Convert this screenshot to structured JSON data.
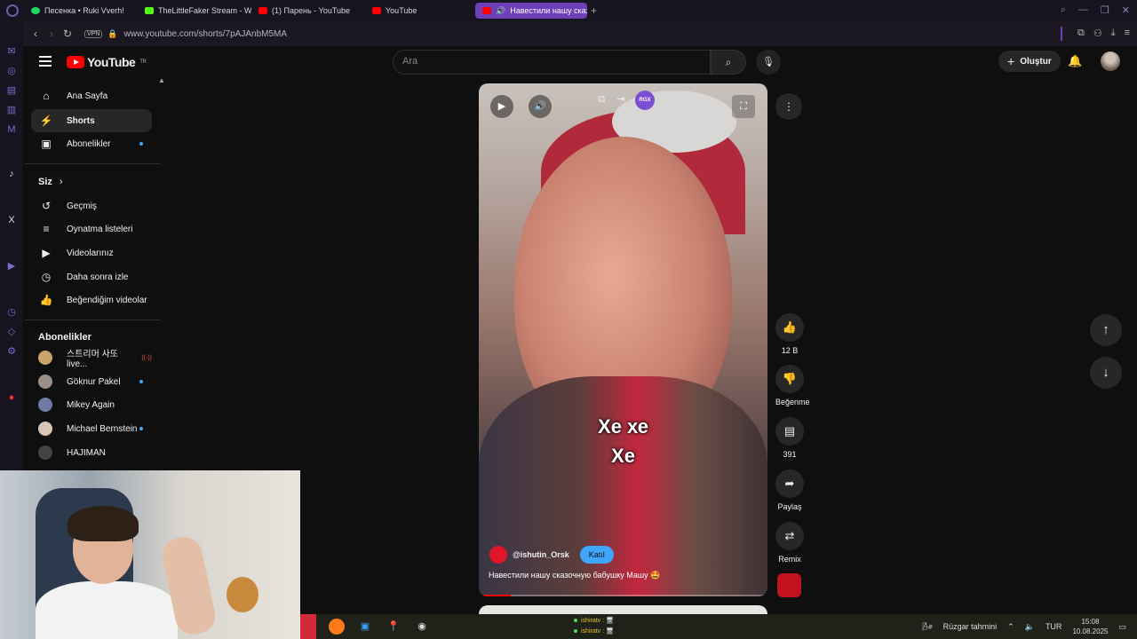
{
  "browser": {
    "tabs": [
      {
        "label": "Песенка • Ruki Vverh!",
        "color": "#1ed760"
      },
      {
        "label": "TheLittleFaker Stream - W",
        "color": "#53fc18"
      },
      {
        "label": "(1) Парень - YouTube",
        "color": "#ff0000"
      },
      {
        "label": "YouTube",
        "color": "#ff0000"
      },
      {
        "label": "Навестили нашу сказ",
        "color": "#ff0000",
        "active": true
      }
    ],
    "new_tab": "+",
    "vpn_label": "VPN",
    "url": "www.youtube.com/shorts/7pAJAnbM5MA"
  },
  "youtube": {
    "logo_text": "YouTube",
    "country_code": "TR",
    "search_placeholder": "Ara",
    "create_label": "Oluştur"
  },
  "guide": {
    "main": [
      {
        "label": "Ana Sayfa",
        "icon": "home-icon",
        "glyph": "⌂"
      },
      {
        "label": "Shorts",
        "icon": "shorts-icon",
        "glyph": "⚡",
        "selected": true
      },
      {
        "label": "Abonelikler",
        "icon": "subscriptions-icon",
        "glyph": "▣",
        "dot": true
      }
    ],
    "you_header": "Siz",
    "you": [
      {
        "label": "Geçmiş",
        "icon": "history-icon",
        "glyph": "↺"
      },
      {
        "label": "Oynatma listeleri",
        "icon": "playlists-icon",
        "glyph": "≡"
      },
      {
        "label": "Videolarınız",
        "icon": "your-videos-icon",
        "glyph": "▶"
      },
      {
        "label": "Daha sonra izle",
        "icon": "watch-later-icon",
        "glyph": "◷"
      },
      {
        "label": "Beğendiğim videolar",
        "icon": "liked-videos-icon",
        "glyph": "👍"
      }
    ],
    "subs_header": "Abonelikler",
    "subs": [
      {
        "label": "스트리머 사또 live...",
        "color": "#c9a46a",
        "live": true
      },
      {
        "label": "Göknur Pakel",
        "color": "#9a8f86",
        "dot": true
      },
      {
        "label": "Mikey Again",
        "color": "#6d7aa8"
      },
      {
        "label": "Michael Bernstein",
        "color": "#d8c6b6",
        "dot": true
      },
      {
        "label": "HAJIMAN",
        "color": "#444444"
      }
    ]
  },
  "short": {
    "caption_line1": "Хе хе",
    "caption_line2": "Хе",
    "channel": "@ishutin_Orsk",
    "join_label": "Katıl",
    "description": "Навестили нашу сказочную бабушку Машу 🤩",
    "progress": 0.11,
    "overlay_badge": "RGX"
  },
  "actions": {
    "like_count": "12 B",
    "dislike_label": "Beğenme",
    "comment_count": "391",
    "share_label": "Paylaş",
    "remix_label": "Remix"
  },
  "chat": [
    {
      "user": "ishiratv :",
      "msg": "🖥"
    },
    {
      "user": "ishiratv :",
      "msg": "🖥"
    }
  ],
  "taskbar": {
    "weather": "Rüzgar tahmini",
    "lang": "TUR",
    "time": "15:08",
    "date": "10.08.2025"
  }
}
